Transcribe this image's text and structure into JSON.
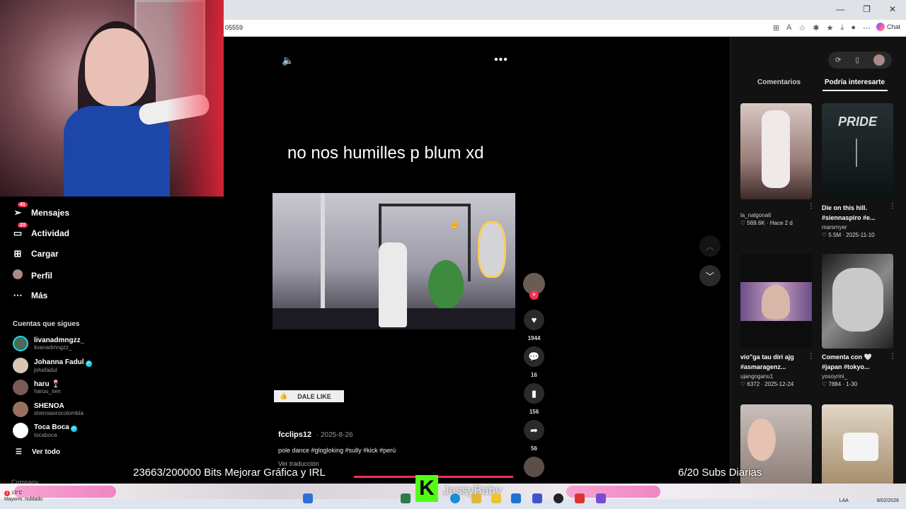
{
  "browser": {
    "url_fragment": "05559",
    "chat_label": "Chat",
    "window_controls": [
      "—",
      "❐",
      "✕"
    ]
  },
  "sidebar": {
    "items": [
      {
        "label": "Mensajes",
        "icon": "send-icon",
        "badge": "41"
      },
      {
        "label": "Actividad",
        "icon": "inbox-icon",
        "badge": "23"
      },
      {
        "label": "Cargar",
        "icon": "upload-icon"
      },
      {
        "label": "Perfil",
        "icon": "profile-avatar-icon"
      },
      {
        "label": "Más",
        "icon": "more-icon"
      }
    ],
    "following_title": "Cuentas que sigues",
    "accounts": [
      {
        "name": "livanadmngzz_",
        "handle": "livanadmngzz_",
        "verified": false
      },
      {
        "name": "Johanna Fadul",
        "handle": "johafadul",
        "verified": true
      },
      {
        "name": "haru 🍷",
        "handle": "haruu_sen",
        "verified": false
      },
      {
        "name": "SHENOA",
        "handle": "shenoaorocolombia",
        "verified": false
      },
      {
        "name": "Toca Boca",
        "handle": "tocaboca",
        "verified": true
      }
    ],
    "see_all": "Ver todo",
    "company": "Company"
  },
  "video": {
    "caption_overlay": "no nos humilles p blum xd",
    "like_button": "DALE LIKE",
    "author": "fcclips12",
    "date": "2025-8-26",
    "description": "pole dance #glogloking #sully #kick #perú",
    "translate": "Ver traducción"
  },
  "actions": {
    "likes": "1944",
    "comments": "16",
    "saves": "156",
    "shares": "56"
  },
  "panel": {
    "tab_comments": "Comentarios",
    "tab_interest": "Podría interesarte",
    "cards": [
      {
        "title": "",
        "user": "la_nalgona6",
        "meta": "♡ 569.6K · Hace 2 d"
      },
      {
        "title": "Die on this hill. #siennaspiro #e...",
        "user": "marsmyer",
        "meta": "♡ 5.5M · 2025-11-10",
        "thumb_text": "PRIDE"
      },
      {
        "title": "vio\"ga tau diri ajg #asmaragenz...",
        "user": "ujangnganu1",
        "meta": "♡ 6372 · 2025-12-24"
      },
      {
        "title": "Comenta con 🤍 #japan #tokyo...",
        "user": "yosoyrini_",
        "meta": "♡ 7884 · 1-30"
      },
      {
        "title": "",
        "user": "",
        "meta": ""
      },
      {
        "title": "",
        "user": "",
        "meta": ""
      }
    ]
  },
  "overlay": {
    "bits": "23663/200000 Bits Mejorar Gráfica y IRL",
    "subs": "6/20 Subs Diarias",
    "channel": "JessyBaby",
    "logo_letter": "K"
  },
  "taskbar": {
    "weather_temp": "13°C",
    "weather_desc": "Mayorm. nublado",
    "weather_badge": "1",
    "lang": "LAA",
    "date": "8/02/2026"
  },
  "colors": {
    "accent": "#fe2c55",
    "kick_green": "#53fc18",
    "verified": "#20d5ec"
  }
}
